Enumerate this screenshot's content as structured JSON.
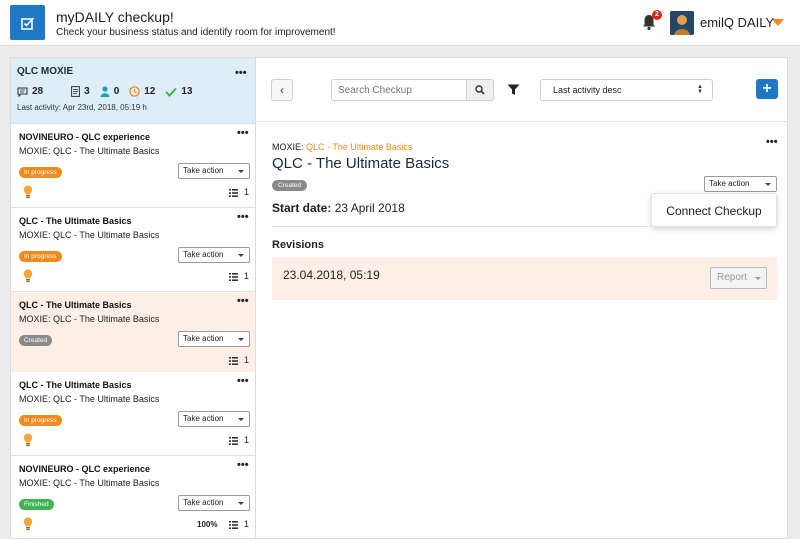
{
  "header": {
    "title": "myDAILY checkup!",
    "subtitle": "Check your business status and identify room for improvement!",
    "notification_count": "2",
    "user_name": "emilQ DAILY",
    "accent_color": "#f08a1e",
    "brand_color": "#1f77c5"
  },
  "left_panel": {
    "title": "QLC MOXIE",
    "more_label": "•••",
    "stats": {
      "comments": "28",
      "documents": "3",
      "users": "0",
      "pending": "12",
      "done": "13"
    },
    "last_activity": "Last activity: Apr 23rd, 2018, 05:19 h",
    "cards": [
      {
        "title": "NOVINEURO - QLC experience",
        "subtitle": "MOXIE: QLC - The Ultimate Basics",
        "status": "In progress",
        "action": "Take action",
        "count": "1",
        "percent": ""
      },
      {
        "title": "QLC - The Ultimate Basics",
        "subtitle": "MOXIE: QLC - The Ultimate Basics",
        "status": "In progress",
        "action": "Take action",
        "count": "1",
        "percent": ""
      },
      {
        "title": "QLC - The Ultimate Basics",
        "subtitle": "MOXIE: QLC - The Ultimate Basics",
        "status": "Created",
        "action": "Take action",
        "count": "1",
        "percent": ""
      },
      {
        "title": "QLC - The Ultimate Basics",
        "subtitle": "MOXIE: QLC - The Ultimate Basics",
        "status": "In progress",
        "action": "Take action",
        "count": "1",
        "percent": ""
      },
      {
        "title": "NOVINEURO - QLC experience",
        "subtitle": "MOXIE: QLC - The Ultimate Basics",
        "status": "Finished",
        "action": "Take action",
        "count": "1",
        "percent": "100%"
      }
    ]
  },
  "toolbar": {
    "back_label": "‹",
    "search_placeholder": "Search Checkup",
    "sort_value": "Last activity desc",
    "add_label": "+"
  },
  "detail": {
    "more_label": "•••",
    "breadcrumb_prefix": "MOXIE: ",
    "breadcrumb_link": "QLC - The Ultimate Basics",
    "title": "QLC - The Ultimate Basics",
    "status": "Created",
    "action": "Take action",
    "start_date_label": "Start date:",
    "start_date_value": "23 April 2018",
    "menu_item": "Connect Checkup",
    "revisions_label": "Revisions",
    "revisions": [
      {
        "date": "23.04.2018, 05:19",
        "report_label": "Report"
      }
    ]
  }
}
